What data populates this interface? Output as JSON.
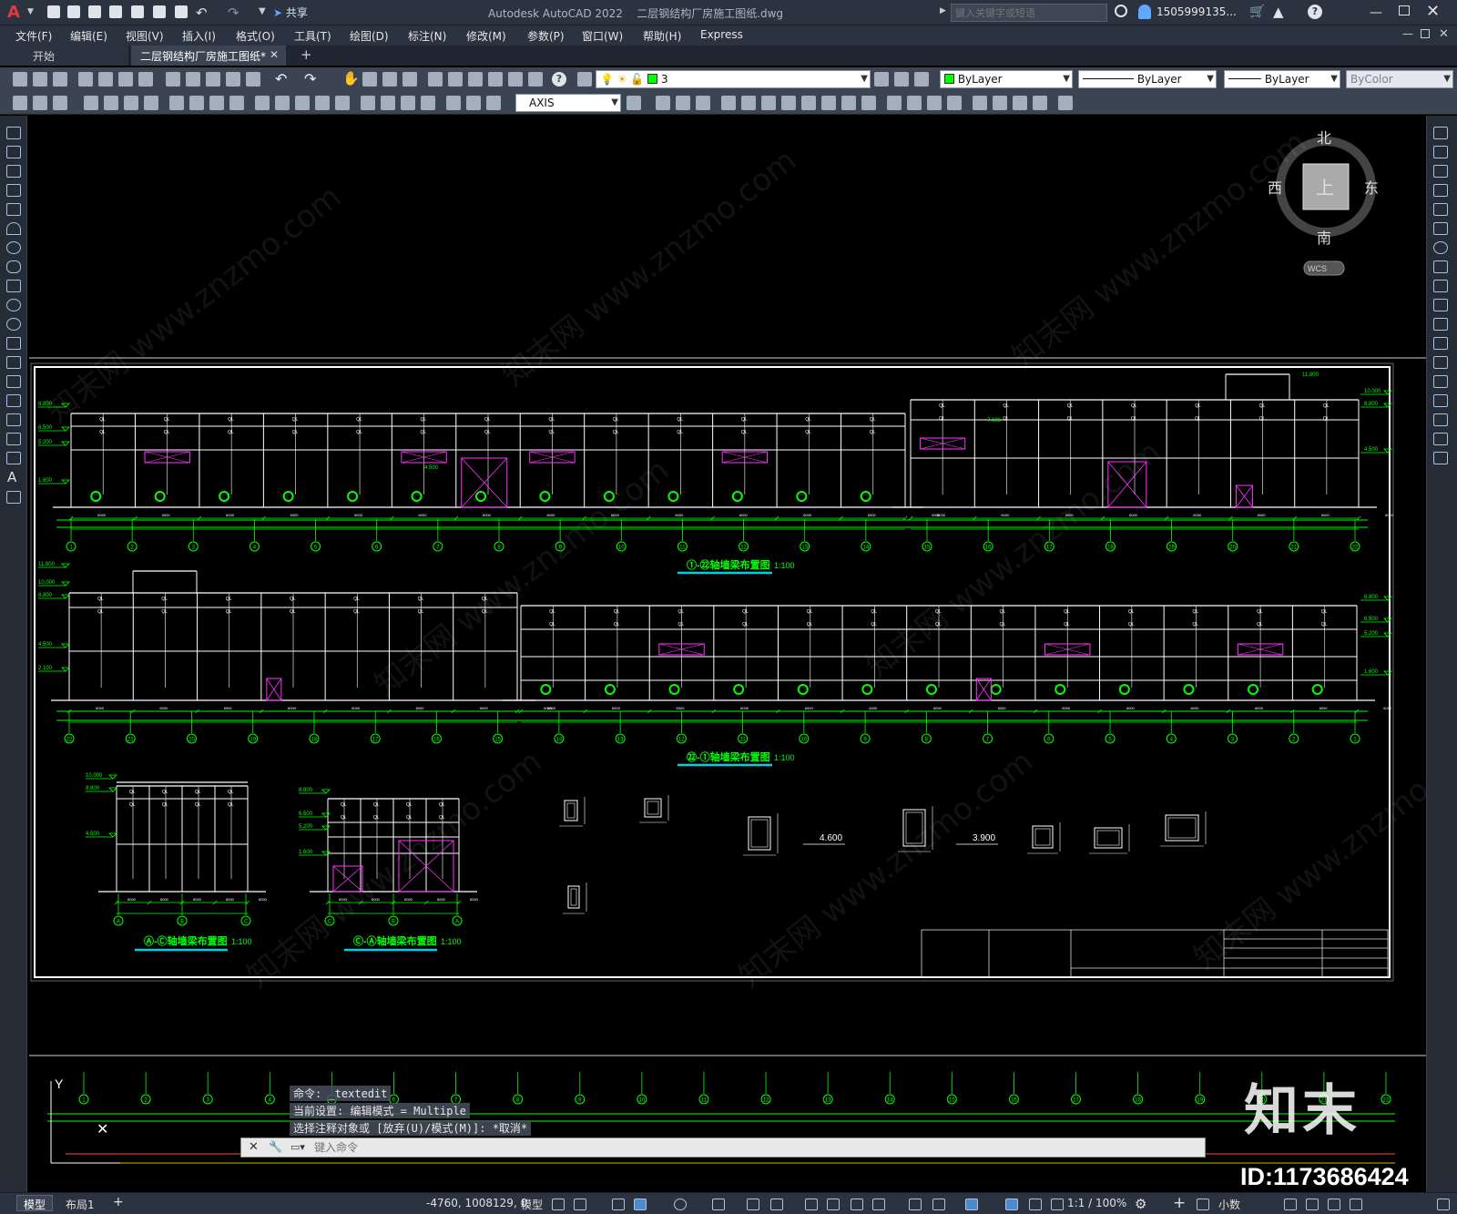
{
  "app": {
    "title": "Autodesk AutoCAD 2022",
    "filename": "二层钢结构厂房施工图纸.dwg",
    "share_label": "共享",
    "search_placeholder": "键入关键字或短语",
    "user": "1505999135...",
    "accent_color": "#c0282d"
  },
  "menu": [
    "文件(F)",
    "编辑(E)",
    "视图(V)",
    "插入(I)",
    "格式(O)",
    "工具(T)",
    "绘图(D)",
    "标注(N)",
    "修改(M)",
    "参数(P)",
    "窗口(W)",
    "帮助(H)",
    "Express"
  ],
  "tabs": [
    {
      "label": "开始",
      "active": false
    },
    {
      "label": "二层钢结构厂房施工图纸*",
      "active": true
    }
  ],
  "toolbar": {
    "layer_value": "3",
    "color_value": "ByLayer",
    "linetype_value": "ByLayer",
    "lineweight_value": "ByLayer",
    "plotstyle_value": "ByColor",
    "dimstyle_value": "AXIS"
  },
  "viewcube": {
    "north": "北",
    "south": "南",
    "east": "东",
    "west": "西",
    "face": "上",
    "wcs": "WCS"
  },
  "drawing": {
    "titles": [
      "①-㉒轴墙梁布置图",
      "㉒-①轴墙梁布置图",
      "Ⓐ-Ⓒ轴墙梁布置图",
      "Ⓒ-Ⓐ轴墙梁布置图"
    ],
    "scale": "1:100",
    "elevations_top": [
      "8.800",
      "6.500",
      "5.200",
      "1.600"
    ],
    "elevations_top_right": [
      "10.000",
      "8.800",
      "4.500"
    ],
    "elevations_mid_left": [
      "11.800",
      "10.000",
      "8.800",
      "4.500",
      "2.100"
    ],
    "elevations_mid_right": [
      "8.800",
      "6.500",
      "5.200",
      "1.600"
    ],
    "elevation_marks": [
      "4.600",
      "3.900",
      "4.500",
      "2.100",
      "7.600",
      "11.800"
    ],
    "axis_top": [
      "1",
      "2",
      "3",
      "4",
      "5",
      "6",
      "7",
      "8",
      "9",
      "10",
      "11",
      "12",
      "13",
      "14",
      "15",
      "16",
      "17",
      "18",
      "19",
      "20",
      "21",
      "22"
    ],
    "axis_mid": [
      "22",
      "21",
      "20",
      "19",
      "18",
      "17",
      "16",
      "15",
      "14",
      "13",
      "12",
      "11",
      "10",
      "9",
      "8",
      "7",
      "6",
      "5",
      "4",
      "3",
      "2",
      "1"
    ],
    "axis_ac": [
      "A",
      "B",
      "C"
    ],
    "axis_ca": [
      "C",
      "B",
      "A"
    ]
  },
  "command": {
    "line1": "命令: _textedit",
    "line2": "当前设置: 编辑模式 = Multiple",
    "line3": "选择注释对象或 [放弃(U)/模式(M)]: *取消*",
    "placeholder": "键入命令"
  },
  "status": {
    "model_tab": "模型",
    "layout_tab": "布局1",
    "coords": "-4760, 1008129, 0",
    "model_label": "模型",
    "scale": "1:1 / 100%",
    "units": "小数"
  },
  "overlay": {
    "brand": "知末",
    "id": "ID:1173686424",
    "watermark": "知末网 www.znzmo.com"
  }
}
